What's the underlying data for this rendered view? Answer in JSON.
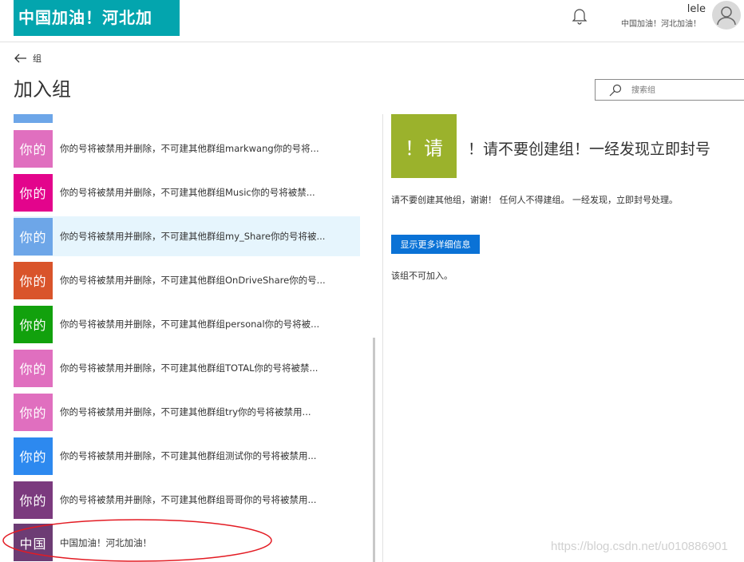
{
  "header": {
    "brand": "中国加油！河北加油！",
    "user_name": "lele",
    "user_subtitle": "中国加油！河北加油！"
  },
  "nav": {
    "back_label": "组",
    "page_title": "加入组",
    "search_placeholder": "搜索组"
  },
  "groups": [
    {
      "tile": "你的",
      "color": "#e06fbf",
      "text": "你的号将被禁用并删除，不可建其他群组markwang你的号将..."
    },
    {
      "tile": "你的",
      "color": "#e3048c",
      "text": "你的号将被禁用并删除，不可建其他群组Music你的号将被禁..."
    },
    {
      "tile": "你的",
      "color": "#6da6e8",
      "text": "你的号将被禁用并删除，不可建其他群组my_Share你的号将被..."
    },
    {
      "tile": "你的",
      "color": "#d9542b",
      "text": "你的号将被禁用并删除，不可建其他群组OnDriveShare你的号..."
    },
    {
      "tile": "你的",
      "color": "#12a10d",
      "text": "你的号将被禁用并删除，不可建其他群组personal你的号将被..."
    },
    {
      "tile": "你的",
      "color": "#e06fbf",
      "text": "你的号将被禁用并删除，不可建其他群组TOTAL你的号将被禁..."
    },
    {
      "tile": "你的",
      "color": "#e06fbf",
      "text": "你的号将被禁用并删除，不可建其他群组try你的号将被禁用..."
    },
    {
      "tile": "你的",
      "color": "#2d89ef",
      "text": "你的号将被禁用并删除，不可建其他群组测试你的号将被禁用..."
    },
    {
      "tile": "你的",
      "color": "#7b3a7e",
      "text": "你的号将被禁用并删除，不可建其他群组哥哥你的号将被禁用..."
    },
    {
      "tile": "中国",
      "color": "#6d3c74",
      "text": "中国加油！河北加油！"
    }
  ],
  "detail": {
    "tile": "！请",
    "title": "！请不要创建组！一经发现立即封号",
    "description": "请不要创建其他组，谢谢！ 任何人不得建组。 一经发现，立即封号处理。",
    "button_label": "显示更多详细信息",
    "status": "该组不可加入。"
  },
  "watermark": "https://blog.csdn.net/u010886901",
  "colors": {
    "brand_bg": "#03a5ae",
    "selected_row": "#e6f5fd",
    "detail_tile": "#9bb22c",
    "button": "#0a72d6",
    "annotation": "#e31b23"
  }
}
